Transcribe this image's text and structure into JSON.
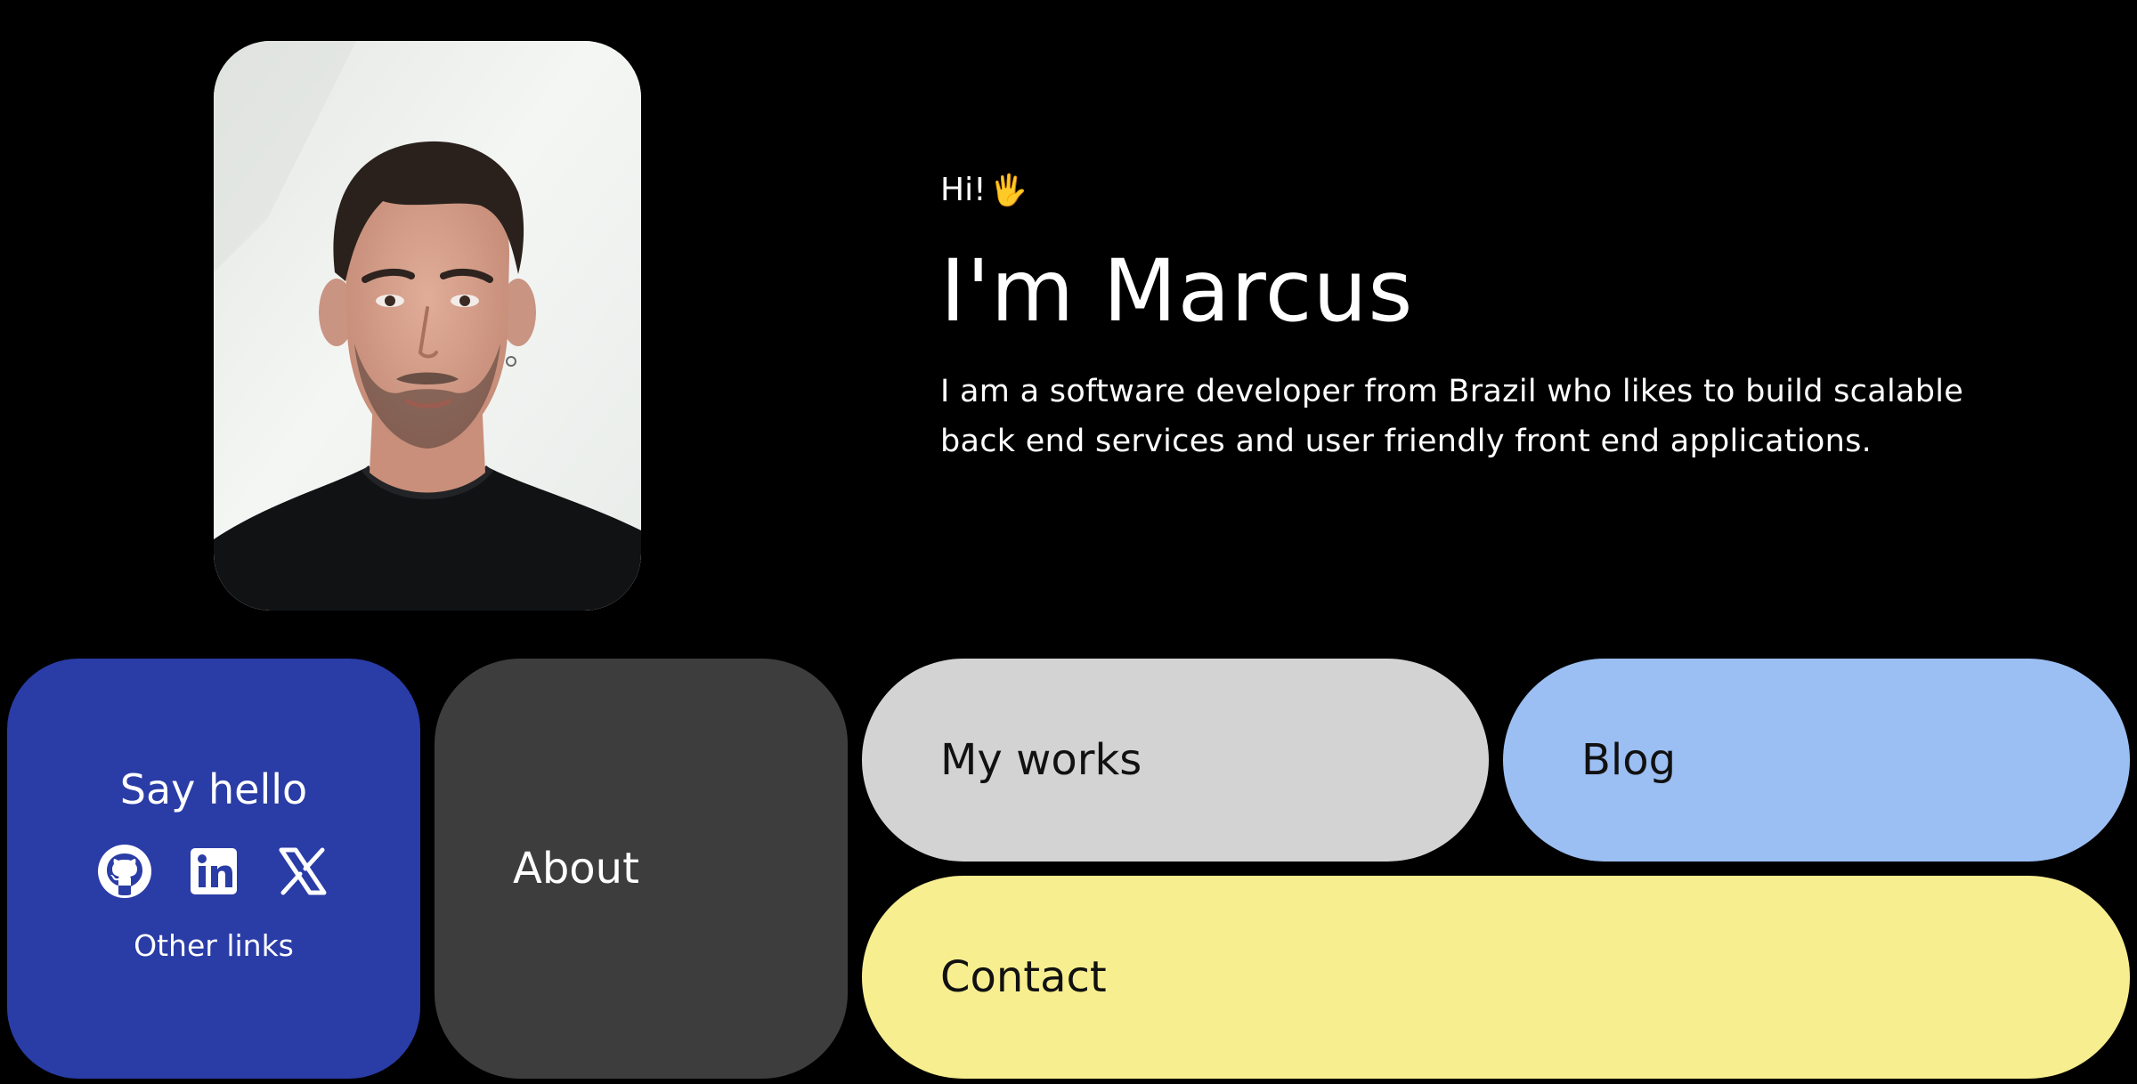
{
  "hero": {
    "greeting": "Hi!",
    "wave_emoji": "🖐",
    "name": "I'm Marcus",
    "intro": "I am a software developer from Brazil who likes to build scalable back end services and user friendly front end applications."
  },
  "portrait": {
    "subject": "portrait-photo"
  },
  "cards": {
    "hello": {
      "title": "Say hello",
      "socials": [
        "github-icon",
        "linkedin-icon",
        "x-icon"
      ],
      "other_links": "Other links",
      "color": "#2a3ca6"
    },
    "about": {
      "label": "About",
      "color": "#3d3d3d"
    },
    "works": {
      "label": "My works",
      "color": "#d3d3d3"
    },
    "blog": {
      "label": "Blog",
      "color": "#9bbff3"
    },
    "contact": {
      "label": "Contact",
      "color": "#f7ee8f"
    }
  }
}
